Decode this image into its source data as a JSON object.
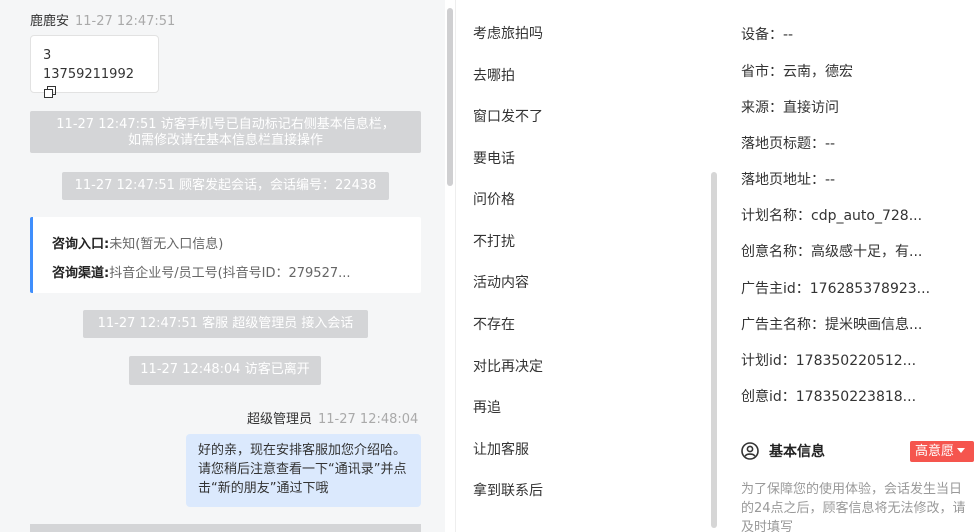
{
  "chat": {
    "visitor_name": "鹿鹿安",
    "visitor_time": "11-27 12:47:51",
    "phone_line1": "3",
    "phone_line2": "13759211992",
    "sys_phone_marked": "11-27 12:47:51 访客手机号已自动标记右侧基本信息栏，如需修改请在基本信息栏直接操作",
    "sys_session_start": "11-27 12:47:51 顾客发起会话，会话编号：22438",
    "consult_entry_label": "咨询入口:",
    "consult_entry_value": "未知(暂无入口信息)",
    "consult_channel_label": "咨询渠道:",
    "consult_channel_value": "抖音企业号/员工号(抖音号ID：279527...",
    "sys_agent_join": "11-27 12:47:51 客服 超级管理员 接入会话",
    "sys_visitor_left": "11-27 12:48:04 访客已离开",
    "agent_name": "超级管理员",
    "agent_time": "11-27 12:48:04",
    "agent_message": "好的亲，现在安排客服加您介绍哈。请您稍后注意查看一下“通讯录”并点击“新的朋友”通过下哦"
  },
  "tags": [
    "考虑旅拍吗",
    "去哪拍",
    "窗口发不了",
    "要电话",
    "问价格",
    "不打扰",
    "活动内容",
    "不存在",
    "对比再决定",
    "再追",
    "让加客服",
    "拿到联系后"
  ],
  "info": {
    "rows": [
      "设备：--",
      "省市：云南，德宏",
      "来源：直接访问",
      "落地页标题：--",
      "落地页地址：--",
      "计划名称：cdp_auto_728...",
      "创意名称：高级感十足，有...",
      "广告主id：176285378923...",
      "广告主名称：提米映画信息...",
      "计划id：178350220512...",
      "创意id：178350223818..."
    ],
    "basic_info_title": "基本信息",
    "intent_label": "高意愿",
    "notice": "为了保障您的使用体验，会话发生当日的24点之后，顾客信息将无法修改，请及时填写"
  },
  "colors": {
    "accent_blue": "#3f8efc",
    "intent_red": "#f5554e",
    "bubble_blue": "#dbe9fd"
  }
}
